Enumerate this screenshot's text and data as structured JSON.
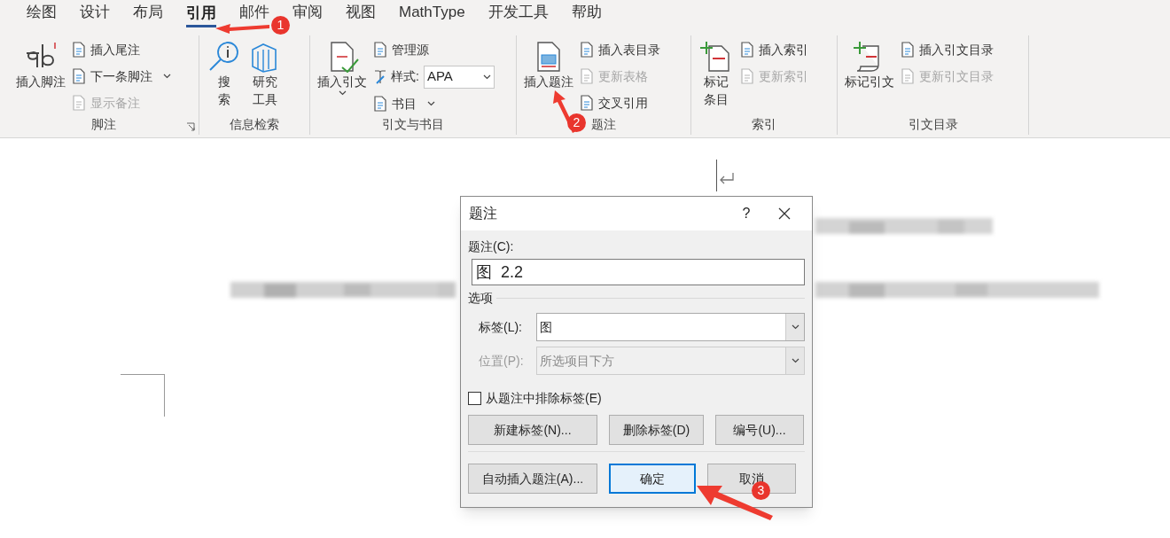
{
  "tabs": [
    {
      "label": "绘图",
      "selected": false
    },
    {
      "label": "设计",
      "selected": false
    },
    {
      "label": "布局",
      "selected": false
    },
    {
      "label": "引用",
      "selected": true
    },
    {
      "label": "邮件",
      "selected": false
    },
    {
      "label": "审阅",
      "selected": false
    },
    {
      "label": "视图",
      "selected": false
    },
    {
      "label": "MathType",
      "selected": false
    },
    {
      "label": "开发工具",
      "selected": false
    },
    {
      "label": "帮助",
      "selected": false
    }
  ],
  "ribbon": {
    "groups": [
      {
        "label": "脚注",
        "launcher": true,
        "items": [
          {
            "kind": "large",
            "lines": [
              "插入脚注"
            ],
            "menu": false
          },
          {
            "kind": "small",
            "label": "插入尾注",
            "disabled": false,
            "menu": false
          },
          {
            "kind": "small",
            "label": "下一条脚注",
            "disabled": false,
            "menu": true
          },
          {
            "kind": "small",
            "label": "显示备注",
            "disabled": true,
            "menu": false
          }
        ]
      },
      {
        "label": "信息检索",
        "launcher": false,
        "items": [
          {
            "kind": "large",
            "lines": [
              "搜",
              "索"
            ],
            "menu": false
          },
          {
            "kind": "large",
            "lines": [
              "研究",
              "工具"
            ],
            "menu": false
          }
        ]
      },
      {
        "label": "引文与书目",
        "launcher": false,
        "items": [
          {
            "kind": "large",
            "lines": [
              "插入引文"
            ],
            "menu": true
          },
          {
            "kind": "small",
            "label": "管理源",
            "disabled": false,
            "menu": false
          },
          {
            "kind": "select",
            "label": "样式:",
            "value": "APA"
          },
          {
            "kind": "small",
            "label": "书目",
            "disabled": false,
            "menu": true
          }
        ]
      },
      {
        "label": "题注",
        "launcher": false,
        "items": [
          {
            "kind": "large",
            "lines": [
              "插入题注"
            ],
            "menu": false
          },
          {
            "kind": "small",
            "label": "插入表目录",
            "disabled": false,
            "menu": false
          },
          {
            "kind": "small",
            "label": "更新表格",
            "disabled": true,
            "menu": false
          },
          {
            "kind": "small",
            "label": "交叉引用",
            "disabled": false,
            "menu": false
          }
        ]
      },
      {
        "label": "索引",
        "launcher": false,
        "items": [
          {
            "kind": "large",
            "lines": [
              "标记",
              "条目"
            ],
            "menu": false
          },
          {
            "kind": "small",
            "label": "插入索引",
            "disabled": false,
            "menu": false
          },
          {
            "kind": "small",
            "label": "更新索引",
            "disabled": true,
            "menu": false
          }
        ]
      },
      {
        "label": "引文目录",
        "launcher": false,
        "items": [
          {
            "kind": "large",
            "lines": [
              "标记引文"
            ],
            "menu": false
          },
          {
            "kind": "small",
            "label": "插入引文目录",
            "disabled": false,
            "menu": false
          },
          {
            "kind": "small",
            "label": "更新引文目录",
            "disabled": true,
            "menu": false
          }
        ]
      }
    ]
  },
  "dialog": {
    "title": "题注",
    "help": "?",
    "caption_label": "题注(C):",
    "caption_value": "图  2.2",
    "options_heading": "选项",
    "fields": [
      {
        "label": "标签(L):",
        "value": "图",
        "disabled": false
      },
      {
        "label": "位置(P):",
        "value": "所选项目下方",
        "disabled": true
      }
    ],
    "exclude_label": {
      "label": "从题注中排除标签(E)",
      "checked": false
    },
    "buttons_row1": [
      "新建标签(N)...",
      "删除标签(D)",
      "编号(U)..."
    ],
    "buttons_row2": [
      {
        "label": "自动插入题注(A)...",
        "default": false
      },
      {
        "label": "确定",
        "default": true
      },
      {
        "label": "取消",
        "default": false
      }
    ]
  },
  "annotations": [
    {
      "number": "1"
    },
    {
      "number": "2"
    },
    {
      "number": "3"
    }
  ]
}
